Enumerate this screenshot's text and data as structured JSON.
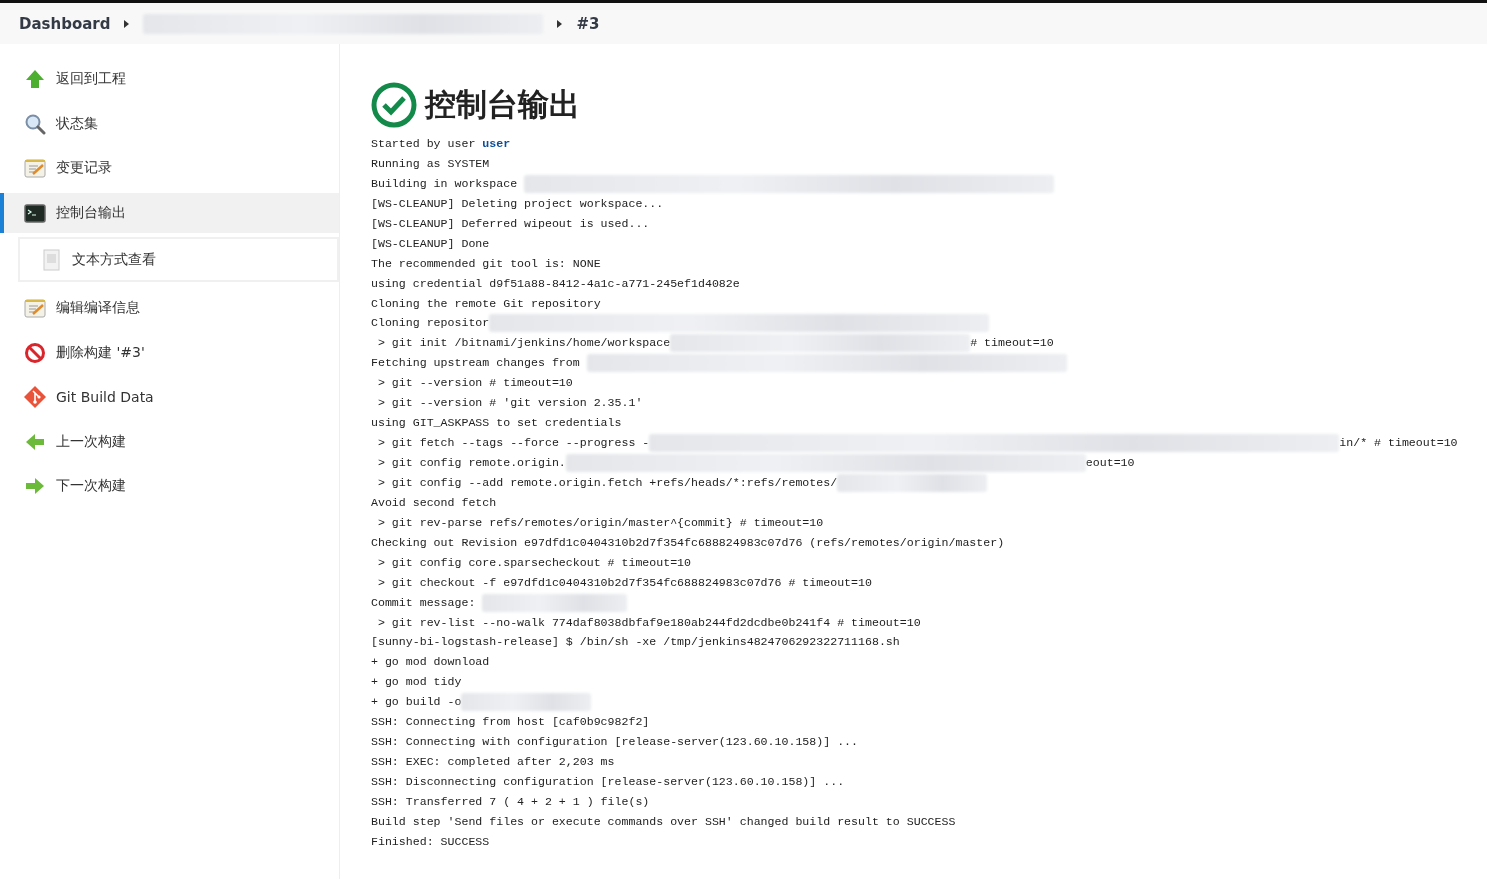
{
  "breadcrumb": [
    {
      "label": "Dashboard",
      "redacted": false
    },
    {
      "redacted": true
    },
    {
      "label": "#3",
      "redacted": false
    }
  ],
  "sidebar": {
    "items": [
      {
        "label": "返回到工程",
        "selected": false
      },
      {
        "label": "状态集",
        "selected": false
      },
      {
        "label": "变更记录",
        "selected": false
      },
      {
        "label": "控制台输出",
        "selected": true,
        "children": [
          {
            "label": "文本方式查看",
            "selected": false
          }
        ]
      },
      {
        "label": "编辑编译信息",
        "selected": false
      },
      {
        "label": "删除构建 '#3'",
        "selected": false
      },
      {
        "label": "Git Build Data",
        "selected": false
      },
      {
        "label": "上一次构建",
        "selected": false
      },
      {
        "label": "下一次构建",
        "selected": false
      }
    ]
  },
  "page": {
    "title": "控制台输出"
  },
  "console": [
    {
      "text": "Started by user ",
      "user": "user"
    },
    {
      "text": "Running as SYSTEM"
    },
    {
      "text": "Building in workspace ",
      "redacted": true
    },
    {
      "text": "[WS-CLEANUP] Deleting project workspace..."
    },
    {
      "text": "[WS-CLEANUP] Deferred wipeout is used..."
    },
    {
      "text": "[WS-CLEANUP] Done"
    },
    {
      "text": "The recommended git tool is: NONE"
    },
    {
      "text": "using credential d9f51a88-8412-4a1c-a771-245ef1d4082e"
    },
    {
      "text": "Cloning the remote Git repository"
    },
    {
      "text": "Cloning repositor",
      "redacted": true
    },
    {
      "text": " > git init /bitnami/jenkins/home/workspace",
      "redacted": true,
      "suffix": "# timeout=10"
    },
    {
      "text": "Fetching upstream changes from ",
      "redacted": true
    },
    {
      "text": " > git --version # timeout=10"
    },
    {
      "text": " > git --version # 'git version 2.35.1'"
    },
    {
      "text": "using GIT_ASKPASS to set credentials"
    },
    {
      "text": " > git fetch --tags --force --progress -",
      "redacted": true,
      "suffix": "in/* # timeout=10"
    },
    {
      "text": " > git config remote.origin.",
      "redacted": true,
      "suffix": "eout=10"
    },
    {
      "text": " > git config --add remote.origin.fetch +refs/heads/*:refs/remotes/",
      "redacted": true
    },
    {
      "text": "Avoid second fetch"
    },
    {
      "text": " > git rev-parse refs/remotes/origin/master^{commit} # timeout=10"
    },
    {
      "text": "Checking out Revision e97dfd1c0404310b2d7f354fc688824983c07d76 (refs/remotes/origin/master)"
    },
    {
      "text": " > git config core.sparsecheckout # timeout=10"
    },
    {
      "text": " > git checkout -f e97dfd1c0404310b2d7f354fc688824983c07d76 # timeout=10"
    },
    {
      "text": "Commit message: ",
      "redacted": true
    },
    {
      "text": " > git rev-list --no-walk 774daf8038dbfaf9e180ab244fd2dcdbe0b241f4 # timeout=10"
    },
    {
      "text": "[sunny-bi-logstash-release] $ /bin/sh -xe /tmp/jenkins4824706292322711168.sh"
    },
    {
      "text": "+ go mod download"
    },
    {
      "text": "+ go mod tidy"
    },
    {
      "text": "+ go build -o",
      "redacted": true
    },
    {
      "text": "SSH: Connecting from host [caf0b9c982f2]"
    },
    {
      "text": "SSH: Connecting with configuration [release-server(123.60.10.158)] ..."
    },
    {
      "text": "SSH: EXEC: completed after 2,203 ms"
    },
    {
      "text": "SSH: Disconnecting configuration [release-server(123.60.10.158)] ..."
    },
    {
      "text": "SSH: Transferred 7 ( 4 + 2 + 1 ) file(s)"
    },
    {
      "text": "Build step 'Send files or execute commands over SSH' changed build result to SUCCESS"
    },
    {
      "text": "Finished: SUCCESS"
    }
  ]
}
